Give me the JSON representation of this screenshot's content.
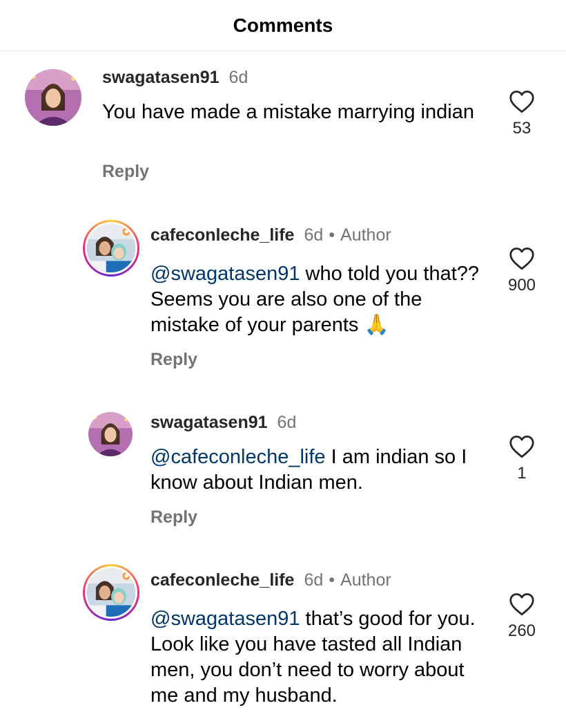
{
  "header": {
    "title": "Comments"
  },
  "comments": [
    {
      "username": "swagatasen91",
      "time": "6d",
      "author_badge": "",
      "text": "You have made a mistake marrying indian",
      "mention": "",
      "reply_label": "Reply",
      "likes": "53"
    },
    {
      "username": "cafeconleche_life",
      "time": "6d",
      "author_badge": "Author",
      "mention": "@swagatasen91",
      "text": "who told you that?? Seems you are also one of the mistake of your parents 🙏",
      "reply_label": "Reply",
      "likes": "900"
    },
    {
      "username": "swagatasen91",
      "time": "6d",
      "author_badge": "",
      "mention": "@cafeconleche_life",
      "text": "I am indian so I know about Indian men.",
      "reply_label": "Reply",
      "likes": "1"
    },
    {
      "username": "cafeconleche_life",
      "time": "6d",
      "author_badge": "Author",
      "mention": "@swagatasen91",
      "text": "that’s good for you. Look like you have tasted all Indian men, you don’t need to worry about me and my husband.",
      "reply_label": "",
      "likes": "260"
    }
  ],
  "icons": {
    "like": "heart-outline-icon"
  },
  "colors": {
    "mention": "#00376b",
    "secondary": "#737373"
  }
}
